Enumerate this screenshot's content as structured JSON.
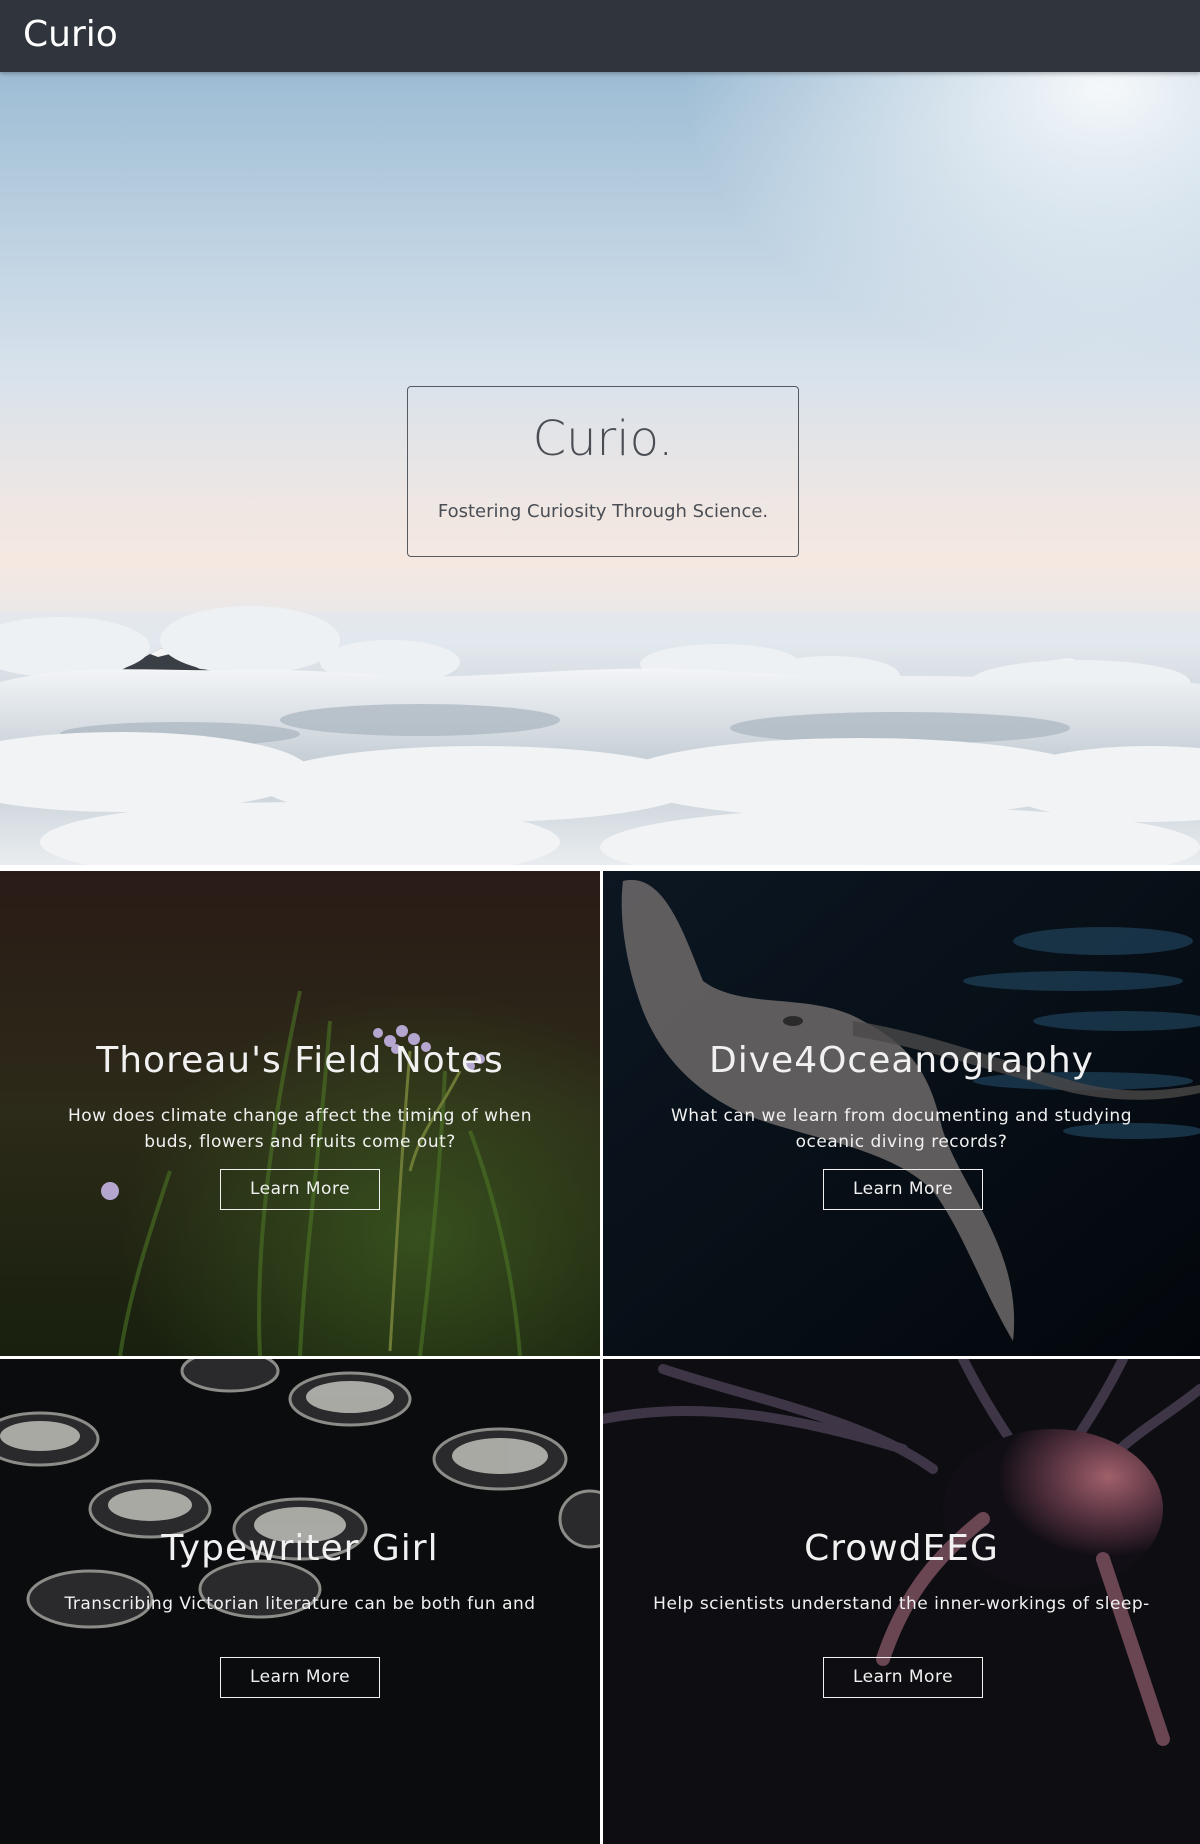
{
  "navbar": {
    "brand": "Curio",
    "background": "#2f343d"
  },
  "hero": {
    "title": "Curio.",
    "tagline": "Fostering Curiosity Through Science."
  },
  "projects": [
    {
      "title": "Thoreau's Field Notes",
      "description": "How does climate change affect the timing of when buds, flowers and fruits come out?",
      "button": "Learn More"
    },
    {
      "title": "Dive4Oceanography",
      "description": "What can we learn from documenting and studying oceanic diving records?",
      "button": "Learn More"
    },
    {
      "title": "Typewriter Girl",
      "description": "Transcribing Victorian literature can be both fun and",
      "button": "Learn More"
    },
    {
      "title": "CrowdEEG",
      "description": "Help scientists understand the inner-workings of sleep-",
      "button": "Learn More"
    }
  ]
}
